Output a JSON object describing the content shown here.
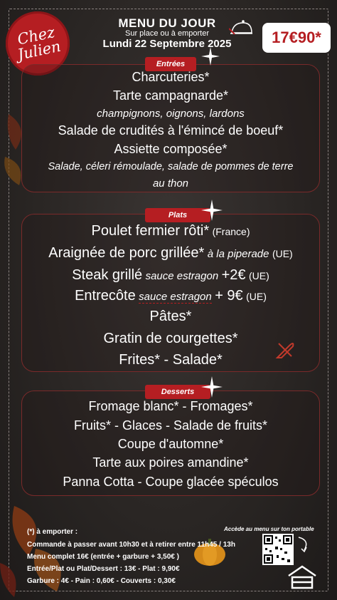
{
  "logo": {
    "line1": "Chez",
    "line2": "Julien"
  },
  "header": {
    "title": "MENU DU JOUR",
    "subtitle": "Sur place ou à emporter",
    "date": "Lundi 22 Septembre 2025"
  },
  "price": "17€90*",
  "entrees": {
    "tag": "Entrées",
    "items": [
      "Charcuteries*",
      "Tarte campagnarde*",
      "champignons, oignons, lardons",
      "Salade de crudités à l'émincé de boeuf*",
      "Assiette composée*",
      "Salade, céleri rémoulade, salade de pommes de terre",
      "au thon"
    ]
  },
  "plats": {
    "tag": "Plats",
    "poulet": "Poulet fermier rôti*",
    "poulet_origin": "(France)",
    "araignee": "Araignée de porc grillée*",
    "araignee_sauce": "à la piperade",
    "araignee_origin": "(UE)",
    "steak": "Steak grillé",
    "steak_sauce": "sauce estragon",
    "steak_price": "+2€",
    "steak_origin": "(UE)",
    "entrecote": "Entrecôte",
    "entrecote_sauce": "sauce estragon",
    "entrecote_price": "+ 9€",
    "entrecote_origin": "(UE)",
    "pates": "Pâtes*",
    "gratin": "Gratin de courgettes*",
    "frites": "Frites* - Salade*"
  },
  "desserts": {
    "tag": "Desserts",
    "items": [
      "Fromage blanc* - Fromages*",
      "Fruits* - Glaces - Salade de fruits*",
      "Coupe d'automne*",
      "Tarte aux poires amandine*",
      "Panna Cotta - Coupe glacée spéculos"
    ]
  },
  "footer": {
    "lines": [
      "(*) à emporter :",
      "Commande à passer avant 10h30 et à retirer entre 11h45 / 13h",
      "Menu complet 16€ (entrée + garbure + 3,50€ )",
      "Entrée/Plat ou Plat/Dessert : 13€ - Plat : 9,90€",
      "Garbure : 4€ - Pain : 0,60€ - Couverts : 0,30€"
    ],
    "qr_caption": "Accède au menu sur ton portable"
  },
  "colors": {
    "accent": "#b51e22",
    "background": "#2a2624",
    "price_bg": "#ffffff"
  },
  "icons": [
    "cloche-icon",
    "sparkle-icon",
    "fork-knife-icon",
    "qr-code",
    "home-icon",
    "pumpkin-icon",
    "leaf-icon"
  ]
}
